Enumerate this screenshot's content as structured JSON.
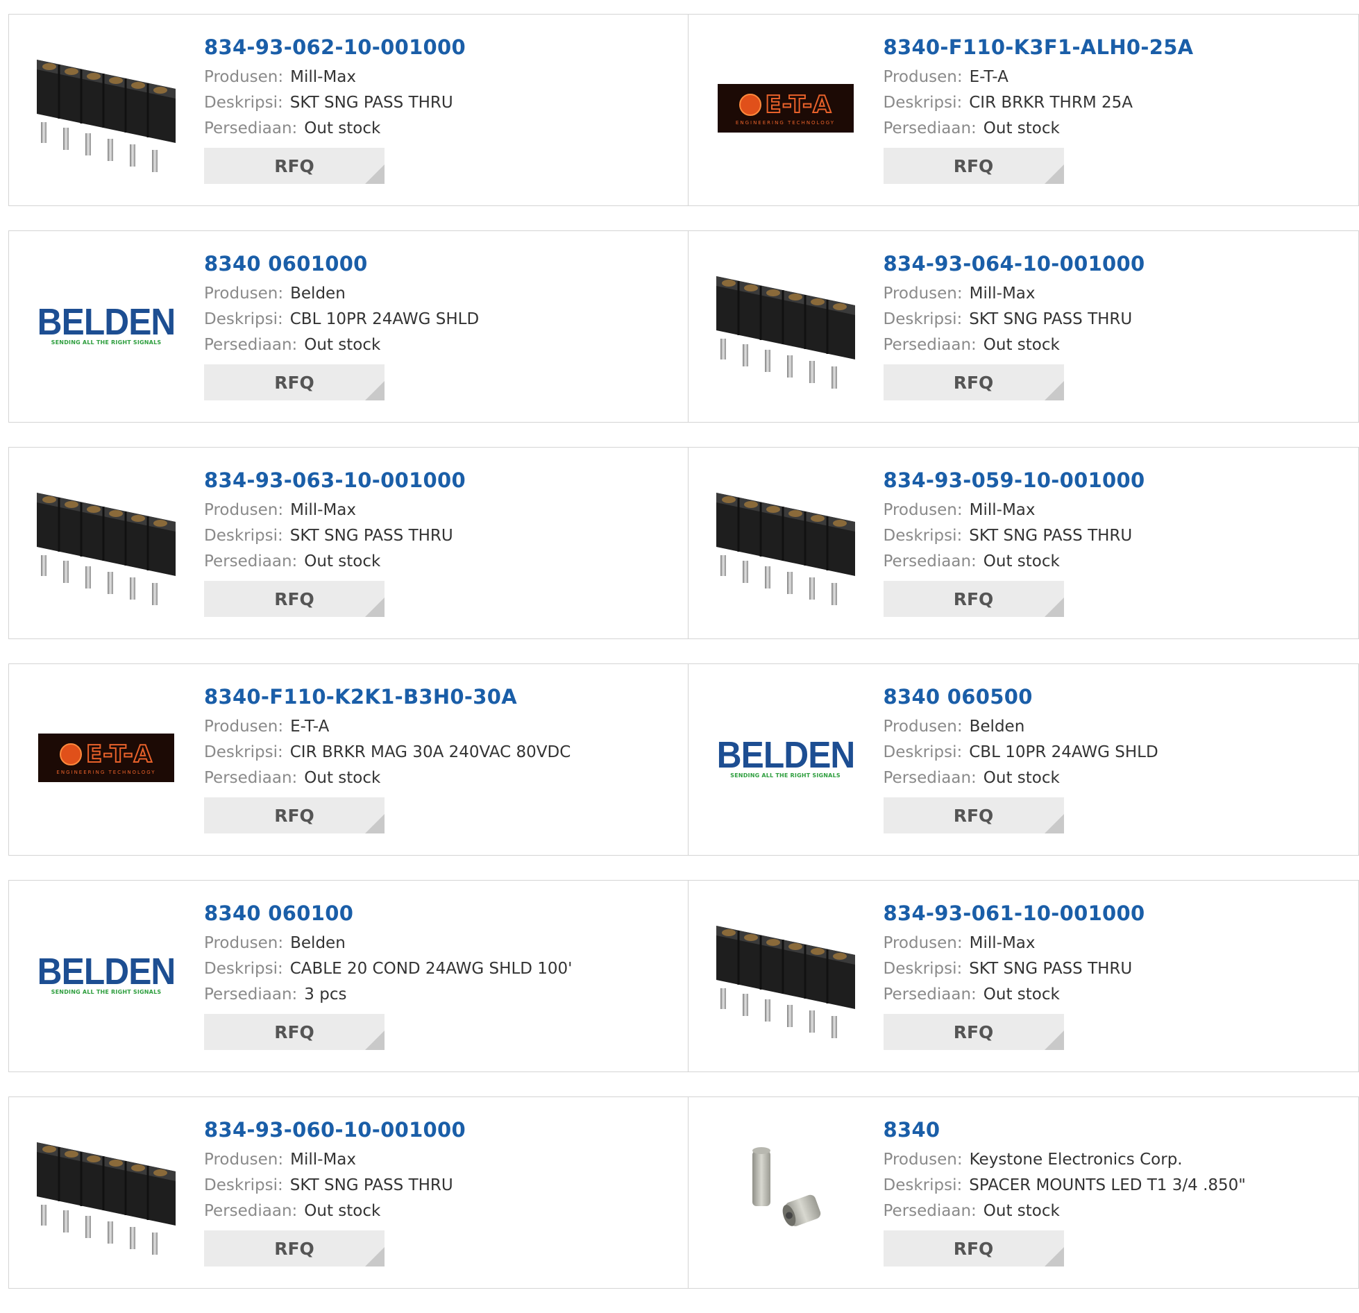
{
  "labels": {
    "manufacturer": "Produsen:",
    "description": "Deskripsi:",
    "stock": "Persediaan:",
    "rfq": "RFQ"
  },
  "logos": {
    "eta_text": "E-T-A",
    "eta_sub": "ENGINEERING TECHNOLOGY",
    "belden_text": "BELDEN",
    "belden_sub": "SENDING ALL THE RIGHT SIGNALS"
  },
  "products": [
    {
      "part": "834-93-062-10-001000",
      "manufacturer": "Mill-Max",
      "description": "SKT SNG PASS THRU",
      "stock": "Out stock",
      "image": "mill-max-header"
    },
    {
      "part": "8340-F110-K3F1-ALH0-25A",
      "manufacturer": "E-T-A",
      "description": "CIR BRKR THRM 25A",
      "stock": "Out stock",
      "image": "eta-logo"
    },
    {
      "part": "8340 0601000",
      "manufacturer": "Belden",
      "description": "CBL 10PR 24AWG SHLD",
      "stock": "Out stock",
      "image": "belden-logo"
    },
    {
      "part": "834-93-064-10-001000",
      "manufacturer": "Mill-Max",
      "description": "SKT SNG PASS THRU",
      "stock": "Out stock",
      "image": "mill-max-header"
    },
    {
      "part": "834-93-063-10-001000",
      "manufacturer": "Mill-Max",
      "description": "SKT SNG PASS THRU",
      "stock": "Out stock",
      "image": "mill-max-header"
    },
    {
      "part": "834-93-059-10-001000",
      "manufacturer": "Mill-Max",
      "description": "SKT SNG PASS THRU",
      "stock": "Out stock",
      "image": "mill-max-header"
    },
    {
      "part": "8340-F110-K2K1-B3H0-30A",
      "manufacturer": "E-T-A",
      "description": "CIR BRKR MAG 30A 240VAC 80VDC",
      "stock": "Out stock",
      "image": "eta-logo"
    },
    {
      "part": "8340 060500",
      "manufacturer": "Belden",
      "description": "CBL 10PR 24AWG SHLD",
      "stock": "Out stock",
      "image": "belden-logo"
    },
    {
      "part": "8340 060100",
      "manufacturer": "Belden",
      "description": "CABLE 20 COND 24AWG SHLD 100'",
      "stock": "3 pcs",
      "image": "belden-logo"
    },
    {
      "part": "834-93-061-10-001000",
      "manufacturer": "Mill-Max",
      "description": "SKT SNG PASS THRU",
      "stock": "Out stock",
      "image": "mill-max-header"
    },
    {
      "part": "834-93-060-10-001000",
      "manufacturer": "Mill-Max",
      "description": "SKT SNG PASS THRU",
      "stock": "Out stock",
      "image": "mill-max-header"
    },
    {
      "part": "8340",
      "manufacturer": "Keystone Electronics Corp.",
      "description": "SPACER MOUNTS LED T1 3/4 .850\"",
      "stock": "Out stock",
      "image": "keystone-spacer"
    }
  ]
}
